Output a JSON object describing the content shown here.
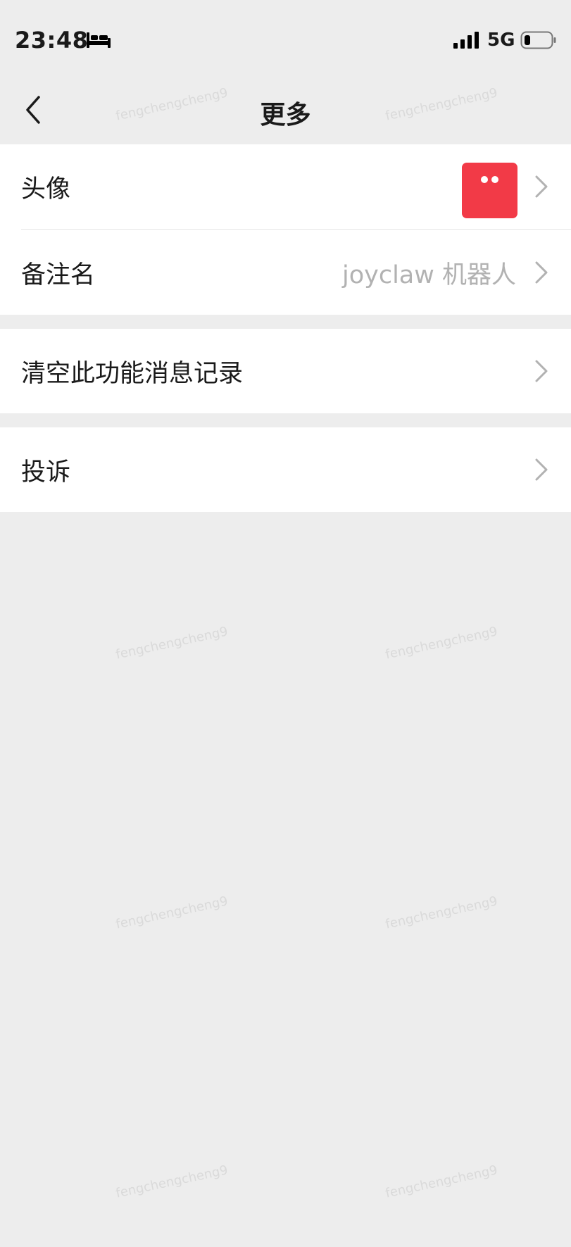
{
  "status_bar": {
    "time": "23:48",
    "network": "5G",
    "icons": [
      "bed-icon",
      "signal-icon",
      "battery-icon"
    ]
  },
  "nav": {
    "title": "更多",
    "back_icon": "chevron-left-icon"
  },
  "groups": [
    {
      "rows": [
        {
          "label": "头像",
          "avatar_color": "#f23a47"
        },
        {
          "label": "备注名",
          "value": "joyclaw 机器人"
        }
      ]
    },
    {
      "rows": [
        {
          "label": "清空此功能消息记录"
        }
      ]
    },
    {
      "rows": [
        {
          "label": "投诉"
        }
      ]
    }
  ],
  "watermark": "fengchengcheng9",
  "colors": {
    "background": "#ededed",
    "row_background": "#ffffff",
    "secondary_text": "#b2b2b2",
    "avatar": "#f23a47"
  }
}
